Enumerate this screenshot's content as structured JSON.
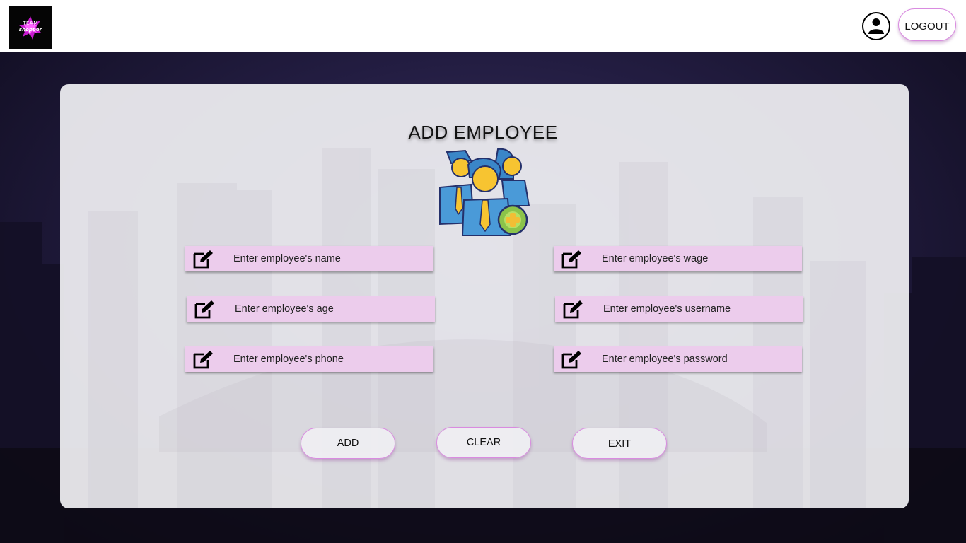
{
  "header": {
    "logo_line1": "TEAM",
    "logo_line2": "shopper",
    "logout_label": "LOGOUT"
  },
  "form": {
    "title": "ADD EMPLOYEE",
    "fields": {
      "name": {
        "placeholder": "Enter employee's name",
        "value": ""
      },
      "wage": {
        "placeholder": "Enter employee's wage",
        "value": ""
      },
      "age": {
        "placeholder": "Enter employee's age",
        "value": ""
      },
      "username": {
        "placeholder": "Enter employee's username",
        "value": ""
      },
      "phone": {
        "placeholder": "Enter employee's phone",
        "value": ""
      },
      "password": {
        "placeholder": "Enter employee's password",
        "value": ""
      }
    },
    "buttons": {
      "add": "ADD",
      "clear": "CLEAR",
      "exit": "EXIT"
    }
  },
  "icons": {
    "logo": "team-shopper-logo",
    "user": "user-account-icon",
    "edit": "edit-icon",
    "illustration": "add-employee-illustration"
  },
  "colors": {
    "field_bg": "#ecccec",
    "button_border": "#d98be0",
    "accent": "#e040e0"
  }
}
